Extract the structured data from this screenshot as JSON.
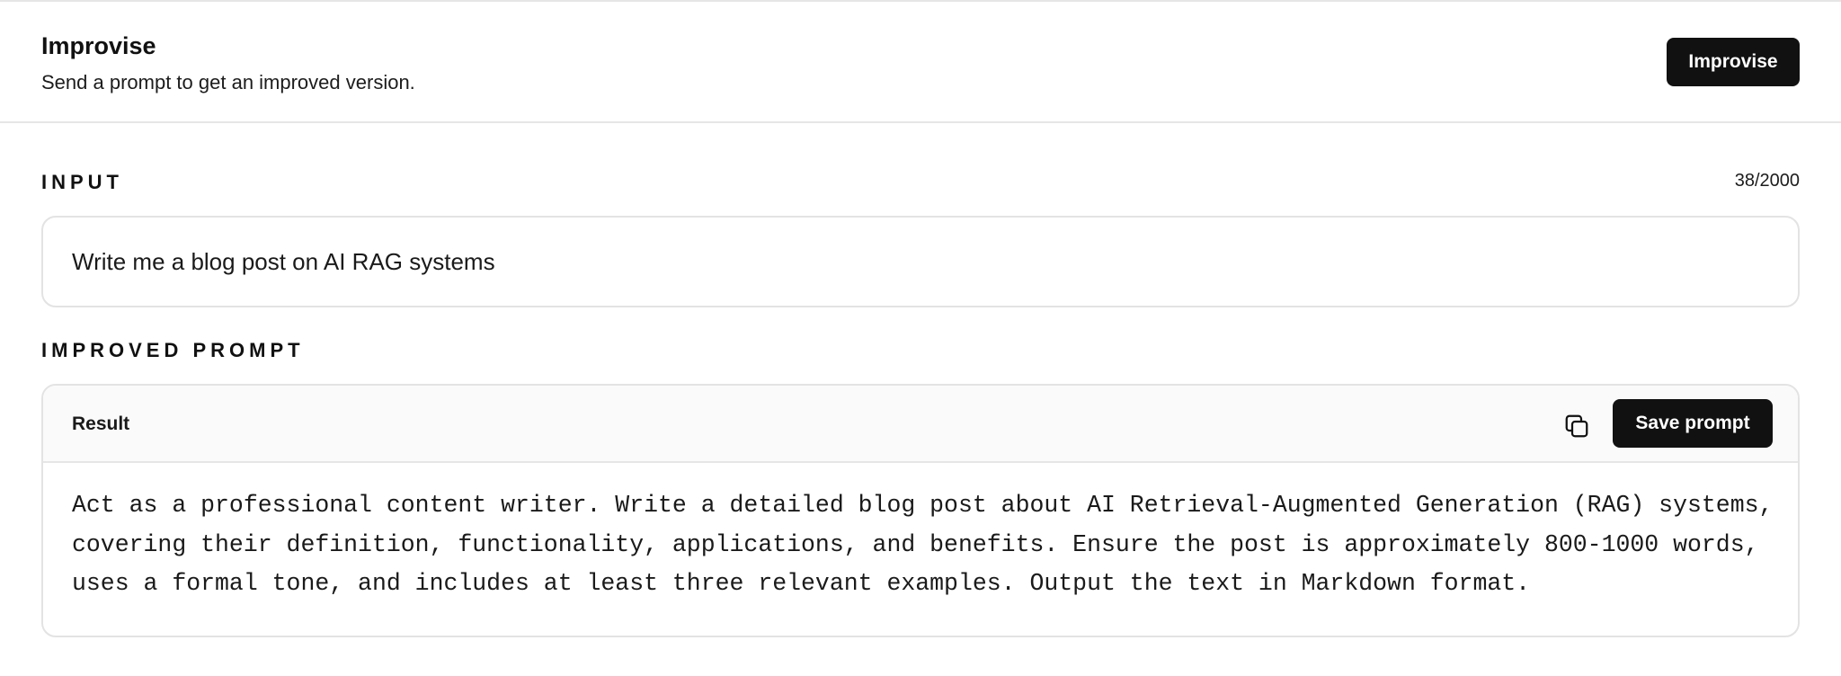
{
  "header": {
    "title": "Improvise",
    "subtitle": "Send a prompt to get an improved version.",
    "improvise_label": "Improvise"
  },
  "input": {
    "section_label": "INPUT",
    "char_count": "38/2000",
    "value": "Write me a blog post on AI RAG systems"
  },
  "improved": {
    "section_label": "IMPROVED PROMPT",
    "result_label": "Result",
    "copy_icon": "copy-icon",
    "save_label": "Save prompt",
    "text": "Act as a professional content writer. Write a detailed blog post about AI Retrieval-Augmented Generation (RAG) systems, covering their definition, functionality, applications, and benefits. Ensure the post is approximately 800-1000 words, uses a formal tone, and includes at least three relevant examples. Output the text in Markdown format."
  },
  "colors": {
    "button_bg": "#111111",
    "border": "#e3e3e3",
    "result_header_bg": "#fafafa"
  }
}
